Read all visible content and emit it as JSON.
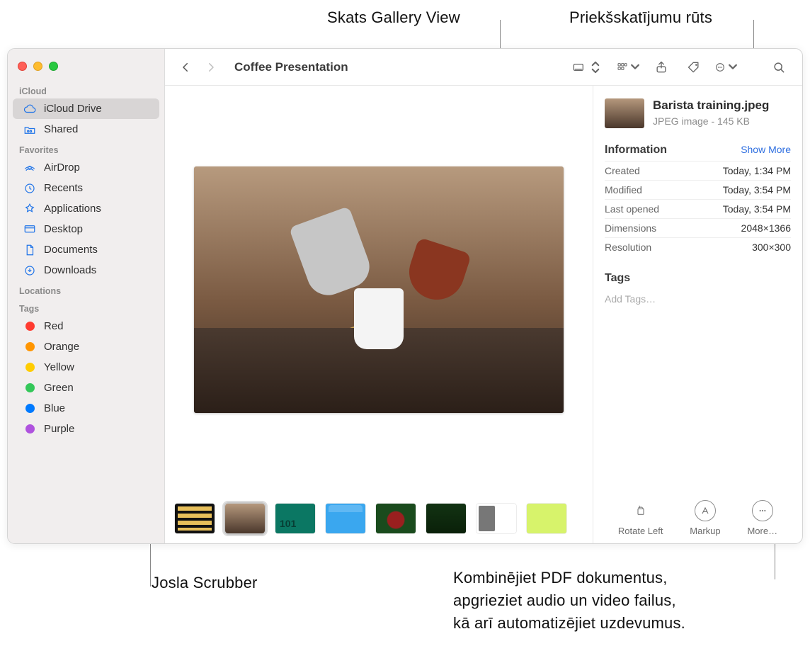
{
  "callouts": {
    "gallery_view": "Skats Gallery View",
    "preview_pane": "Priekšskatījumu rūts",
    "scrubber": "Josla Scrubber",
    "more_desc": "Kombinējiet PDF dokumentus,\napgrieziet audio un video failus,\nkā arī automatizējiet uzdevumus."
  },
  "window": {
    "title": "Coffee Presentation"
  },
  "sidebar": {
    "sections": {
      "icloud_label": "iCloud",
      "favorites_label": "Favorites",
      "locations_label": "Locations",
      "tags_label": "Tags"
    },
    "icloud": [
      {
        "label": "iCloud Drive",
        "selected": true
      },
      {
        "label": "Shared"
      }
    ],
    "favorites": [
      {
        "label": "AirDrop"
      },
      {
        "label": "Recents"
      },
      {
        "label": "Applications"
      },
      {
        "label": "Desktop"
      },
      {
        "label": "Documents"
      },
      {
        "label": "Downloads"
      }
    ],
    "tags": [
      {
        "label": "Red",
        "color": "#ff3b30"
      },
      {
        "label": "Orange",
        "color": "#ff9500"
      },
      {
        "label": "Yellow",
        "color": "#ffcc00"
      },
      {
        "label": "Green",
        "color": "#34c759"
      },
      {
        "label": "Blue",
        "color": "#007aff"
      },
      {
        "label": "Purple",
        "color": "#af52de"
      }
    ]
  },
  "preview": {
    "filename": "Barista training.jpeg",
    "kind": "JPEG image - 145 KB",
    "info_heading": "Information",
    "show_more": "Show More",
    "rows": [
      {
        "k": "Created",
        "v": "Today, 1:34 PM"
      },
      {
        "k": "Modified",
        "v": "Today, 3:54 PM"
      },
      {
        "k": "Last opened",
        "v": "Today, 3:54 PM"
      },
      {
        "k": "Dimensions",
        "v": "2048×1366"
      },
      {
        "k": "Resolution",
        "v": "300×300"
      }
    ],
    "tags_heading": "Tags",
    "tags_placeholder": "Add Tags…",
    "actions": {
      "rotate_left": "Rotate Left",
      "markup": "Markup",
      "more": "More…"
    }
  }
}
